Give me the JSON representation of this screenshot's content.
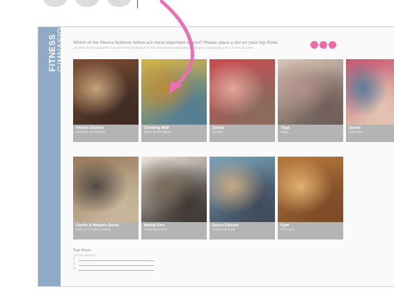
{
  "brand": {
    "line1": "FITNESS",
    "line2": "GIMNASIO"
  },
  "question": {
    "english": "Which of the fitness features below are most important to you? Please place a dot on your top three.",
    "spanish": "¿Cuáles de las siguientes funciones del gimnasio son más importantes para usted? Coloque una pegatina en sus tres favoritas."
  },
  "dots_color": "#ee6aa7",
  "cards": [
    {
      "title": "Fitness Studios",
      "subtitle": "Estudios de Fitness",
      "colors": [
        "#7a4e34",
        "#c9a27c",
        "#3d2a22"
      ]
    },
    {
      "title": "Climbing Wall",
      "subtitle": "Muro de Escalada",
      "colors": [
        "#d7b448",
        "#b98a3a",
        "#4f7c95"
      ]
    },
    {
      "title": "Zumba",
      "subtitle": "Zumba",
      "colors": [
        "#c84a52",
        "#e3a59a",
        "#8a6b5d"
      ]
    },
    {
      "title": "Yoga",
      "subtitle": "Yoga",
      "colors": [
        "#d8c6b6",
        "#b4928a",
        "#6d5c57"
      ]
    },
    {
      "title": "Sports",
      "subtitle": "Deportes",
      "colors": [
        "#c7566f",
        "#5a7c9a",
        "#e3c6b2"
      ]
    },
    {
      "title": "Cardio & Weights Room",
      "subtitle": "Sala de Cardio y Pesas",
      "colors": [
        "#9a7b5c",
        "#514a44",
        "#c9b79c"
      ]
    },
    {
      "title": "Martial Arts",
      "subtitle": "Artes Marciales",
      "colors": [
        "#e9e3da",
        "#7b6a5a",
        "#3b3430"
      ]
    },
    {
      "title": "Dance Classes",
      "subtitle": "Clases de Baile",
      "colors": [
        "#7aa2b8",
        "#c8a983",
        "#3f4a5a"
      ]
    },
    {
      "title": "Gym",
      "subtitle": "Gimnasio",
      "colors": [
        "#b77a3e",
        "#e1b071",
        "#7c4a26"
      ]
    }
  ],
  "top_three": {
    "title": "Top three:",
    "subtitle": "Las tres mejores:",
    "items": [
      "1.",
      "2.",
      "3."
    ]
  },
  "arrow_color": "#e96fb7"
}
